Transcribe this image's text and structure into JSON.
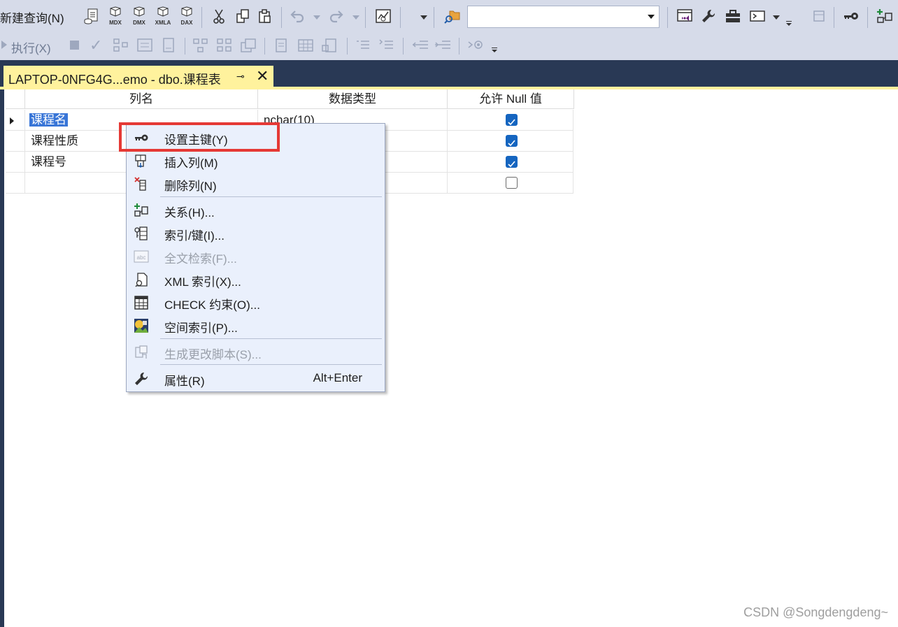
{
  "toolbar1": {
    "new_query": "新建查询(N)",
    "icons": [
      "db-query-icon",
      "mdx-icon",
      "dmx-icon",
      "xmla-icon",
      "dax-icon",
      "cut-icon",
      "copy-icon",
      "paste-icon",
      "undo-icon",
      "redo-icon",
      "activity-monitor-icon",
      "solution-explorer-icon",
      "vs-icon",
      "wrench-icon",
      "toolbox-icon",
      "terminal-icon",
      "key-icon",
      "add-relation-icon"
    ],
    "mdx": "MDX",
    "dmx": "DMX",
    "xmla": "XMLA",
    "dax": "DAX",
    "combo_value": ""
  },
  "toolbar2": {
    "execute": "执行(X)"
  },
  "tab": {
    "title": "LAPTOP-0NFG4G...emo - dbo.课程表",
    "pin": "⊸",
    "close": "✕"
  },
  "grid": {
    "headers": [
      "列名",
      "数据类型",
      "允许 Null 值"
    ],
    "rows": [
      {
        "name": "课程名",
        "type": "nchar(10)",
        "allow_null": true,
        "selected": true
      },
      {
        "name": "课程性质",
        "type": "",
        "allow_null": true
      },
      {
        "name": "课程号",
        "type": "",
        "allow_null": true
      },
      {
        "name": "",
        "type": "",
        "allow_null": false
      }
    ]
  },
  "context_menu": {
    "items": [
      {
        "label": "设置主键(Y)",
        "icon": "key-icon",
        "enabled": true
      },
      {
        "label": "插入列(M)",
        "icon": "insert-column-icon",
        "enabled": true
      },
      {
        "label": "删除列(N)",
        "icon": "delete-column-icon",
        "enabled": true
      },
      {
        "label": "关系(H)...",
        "icon": "relationship-icon",
        "enabled": true
      },
      {
        "label": "索引/键(I)...",
        "icon": "index-icon",
        "enabled": true
      },
      {
        "label": "全文检索(F)...",
        "icon": "fulltext-icon",
        "enabled": false
      },
      {
        "label": "XML 索引(X)...",
        "icon": "xml-index-icon",
        "enabled": true
      },
      {
        "label": "CHECK 约束(O)...",
        "icon": "check-constraint-icon",
        "enabled": true
      },
      {
        "label": "空间索引(P)...",
        "icon": "spatial-index-icon",
        "enabled": true
      },
      {
        "label": "生成更改脚本(S)...",
        "icon": "script-icon",
        "enabled": false
      },
      {
        "label": "属性(R)",
        "icon": "wrench-icon",
        "enabled": true,
        "shortcut": "Alt+Enter"
      }
    ]
  },
  "watermark": "CSDN @Songdengdeng~",
  "colors": {
    "toolbar_bg": "#d6dbe9",
    "tab_band": "#293955",
    "tab_active": "#fff29d",
    "menu_bg": "#eaf0fc",
    "highlight_box": "#e53935",
    "checkbox": "#1565c0"
  }
}
